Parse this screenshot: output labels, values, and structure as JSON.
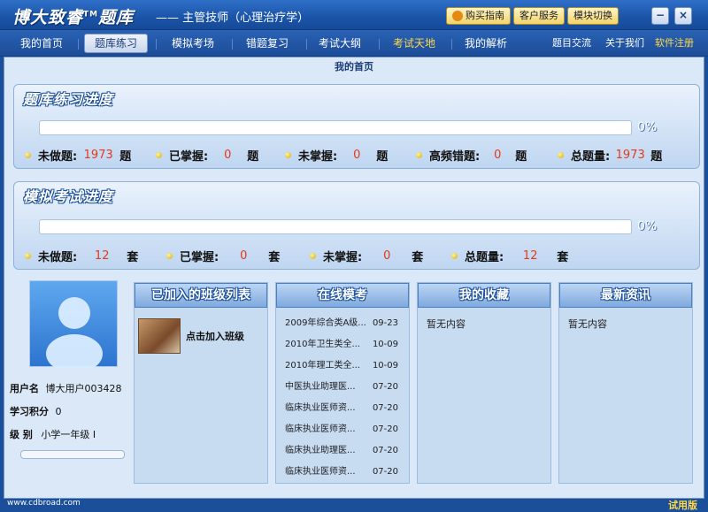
{
  "window": {
    "brand": "博大致睿",
    "tm": "TM",
    "brand_suffix": "题库",
    "subtitle": "—— 主管技师（心理治疗学）",
    "top_buttons": [
      "购买指南",
      "客户服务",
      "模块切换"
    ],
    "minimize": "−",
    "close": "×"
  },
  "nav": {
    "items": [
      "我的首页",
      "题库练习",
      "模拟考场",
      "错题复习",
      "考试大纲",
      "考试天地",
      "我的解析"
    ],
    "right": [
      "题目交流",
      "关于我们",
      "软件注册"
    ]
  },
  "breadcrumb": "我的首页",
  "practice": {
    "title": "题库练习进度",
    "percent": "0%",
    "progress": 0,
    "stats": [
      {
        "label": "未做题:",
        "value": "1973",
        "unit": "题"
      },
      {
        "label": "已掌握:",
        "value": "0",
        "unit": "题"
      },
      {
        "label": "未掌握:",
        "value": "0",
        "unit": "题"
      },
      {
        "label": "高频错题:",
        "value": "0",
        "unit": "题"
      },
      {
        "label": "总题量:",
        "value": "1973",
        "unit": "题"
      }
    ]
  },
  "exam": {
    "title": "模拟考试进度",
    "percent": "0%",
    "progress": 0,
    "stats": [
      {
        "label": "未做题:",
        "value": "12",
        "unit": "套"
      },
      {
        "label": "已掌握:",
        "value": "0",
        "unit": "套"
      },
      {
        "label": "未掌握:",
        "value": "0",
        "unit": "套"
      },
      {
        "label": "总题量:",
        "value": "12",
        "unit": "套"
      }
    ]
  },
  "user": {
    "name_label": "用户名",
    "name": "博大用户003428",
    "points_label": "学习积分",
    "points": "0",
    "level_label": "级 别",
    "level": "小学一年级 I"
  },
  "columns": {
    "classes": {
      "title": "已加入的班级列表",
      "join_text": "点击加入班级"
    },
    "online_exam": {
      "title": "在线模考",
      "rows": [
        {
          "name": "2009年综合类A级...",
          "date": "09-23"
        },
        {
          "name": "2010年卫生类全...",
          "date": "10-09"
        },
        {
          "name": "2010年理工类全...",
          "date": "10-09"
        },
        {
          "name": "中医执业助理医...",
          "date": "07-20"
        },
        {
          "name": "临床执业医师资...",
          "date": "07-20"
        },
        {
          "name": "临床执业医师资...",
          "date": "07-20"
        },
        {
          "name": "临床执业助理医...",
          "date": "07-20"
        },
        {
          "name": "临床执业医师资...",
          "date": "07-20"
        }
      ]
    },
    "favorites": {
      "title": "我的收藏",
      "empty": "暂无内容"
    },
    "news": {
      "title": "最新资讯",
      "empty": "暂无内容"
    }
  },
  "footer": {
    "left": "www.cdbroad.com",
    "right": "试用版"
  }
}
